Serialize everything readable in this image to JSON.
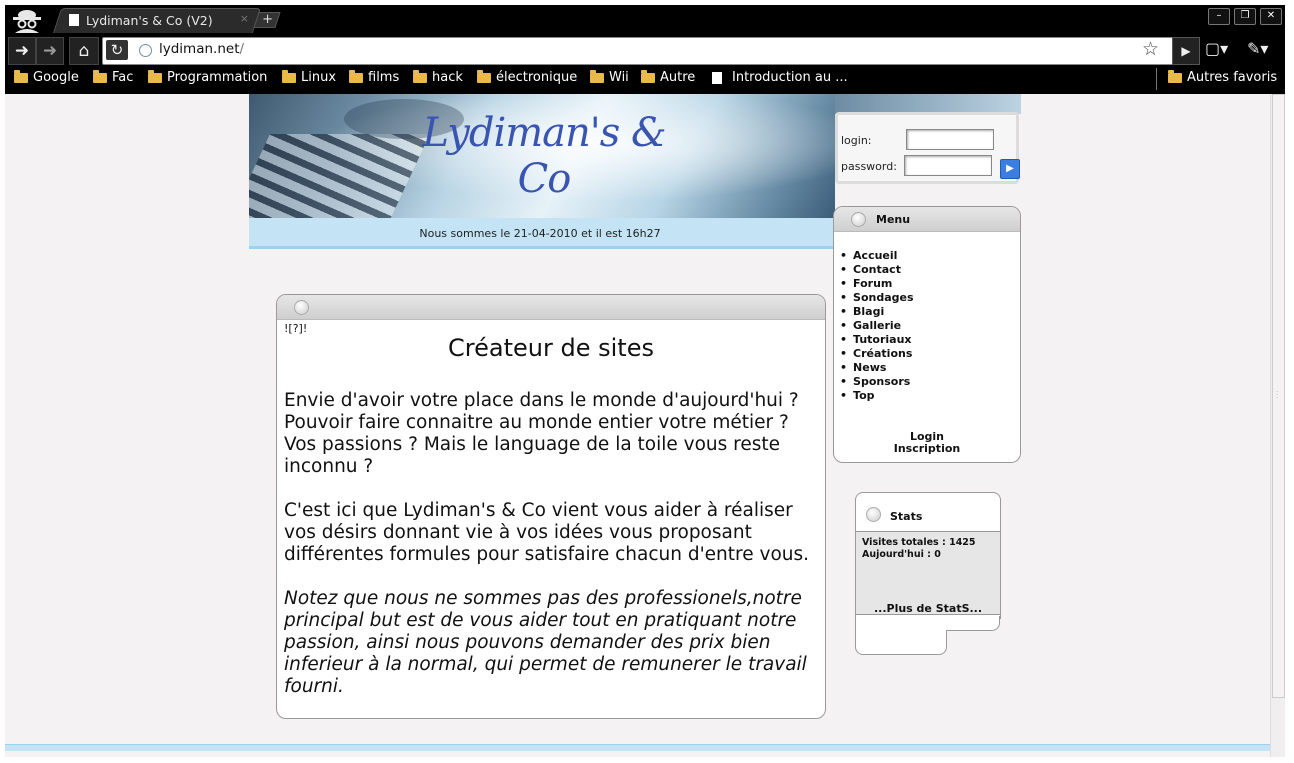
{
  "browser": {
    "tab_title": "Lydiman's & Co (V2)",
    "tab_close": "×",
    "new_tab": "+",
    "window_buttons": [
      "–",
      "❐",
      "✕"
    ],
    "url_host": "lydiman.net",
    "url_path": "/",
    "bookmarks": [
      "Google",
      "Fac",
      "Programmation",
      "Linux",
      "films",
      "hack",
      "électronique",
      "Wii",
      "Autre",
      "Introduction au ..."
    ],
    "other_bookmarks": "Autres favoris"
  },
  "header": {
    "site_title": "Lydiman's & Co",
    "date_text": "Nous sommes le 21-04-2010 et il est 16h27"
  },
  "login": {
    "login_label": "login:",
    "password_label": "password:"
  },
  "menu": {
    "title": "Menu",
    "items": [
      "Accueil",
      "Contact",
      "Forum",
      "Sondages",
      "Blagi",
      "Gallerie",
      "Tutoriaux",
      "Créations",
      "News",
      "Sponsors",
      "Top"
    ],
    "login_link": "Login",
    "signup_link": "Inscription"
  },
  "stats": {
    "title": "Stats",
    "total_visits": "Visites totales : 1425",
    "today": "Aujourd'hui : 0",
    "more": "...Plus de StatS..."
  },
  "content": {
    "image_alt": "![?]!",
    "title": "Créateur de sites",
    "p1": "Envie d'avoir votre place dans le monde d'aujourd'hui ? Pouvoir faire connaitre au monde entier votre métier ? Vos passions ? Mais le language de la toile vous reste inconnu ?",
    "p2": "C'est ici que Lydiman's & Co vient vous aider à réaliser vos désirs donnant vie à vos idées vous proposant différentes formules pour satisfaire chacun d'entre vous.",
    "p3": "Notez que nous ne sommes pas des professionels,notre principal but est de vous aider tout en pratiquant notre passion, ainsi nous pouvons demander des prix bien inferieur à la normal, qui permet de remunerer le travail fourni."
  }
}
